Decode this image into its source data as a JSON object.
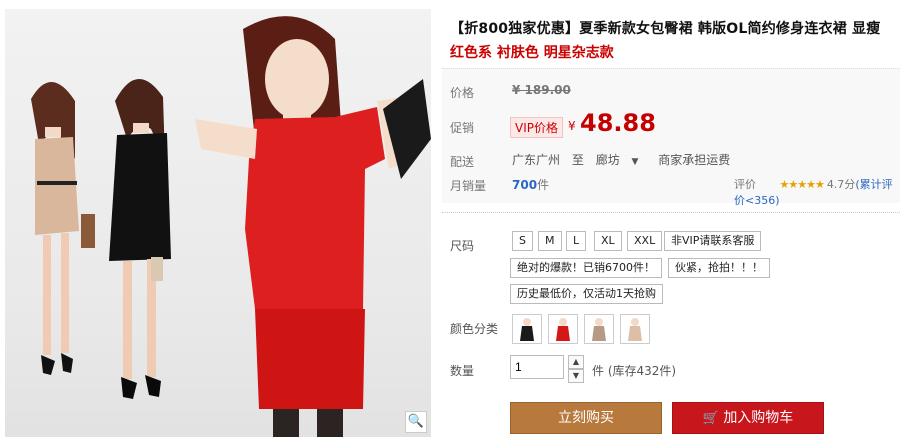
{
  "product": {
    "title": "【折800独家优惠】夏季新款女包臀裙 韩版OL简约修身连衣裙 显瘦",
    "subtitle": "红色系 衬肤色 明星杂志款"
  },
  "price": {
    "original_label": "价格",
    "original_value": "¥ 189.00",
    "promo_label": "促销",
    "vip_tag": "VIP价格",
    "currency": "¥",
    "promo_value": "48.88"
  },
  "shipping": {
    "label": "配送",
    "from": "广东广州",
    "to_word": "至",
    "destination": "廊坊",
    "fee": "商家承担运费"
  },
  "sales": {
    "label": "月销量",
    "value": "700",
    "unit": "件",
    "rating_label": "评价",
    "stars": "★★★★★",
    "score": "4.7分",
    "cumulative": "(累计评价<356)"
  },
  "sizes": {
    "label": "尺码",
    "options": [
      "S",
      "M",
      "L",
      "XL",
      "XXL",
      "非VIP请联系客服",
      "绝对的爆款！已销6700件！",
      "伙紧，抢拍！！！",
      "历史最低价，仅活动1天抢购"
    ]
  },
  "colors": {
    "label": "颜色分类",
    "swatches": [
      "#1a1a1a",
      "#d41818",
      "#b69a85",
      "#dcbfa6"
    ]
  },
  "quantity": {
    "label": "数量",
    "value": "1",
    "unit": "件",
    "stock": "(库存432件)"
  },
  "actions": {
    "buy_now": "立刻购买",
    "add_to_cart": "加入购物车"
  },
  "icons": {
    "zoom": "magnifier-icon",
    "cart": "cart-icon"
  }
}
